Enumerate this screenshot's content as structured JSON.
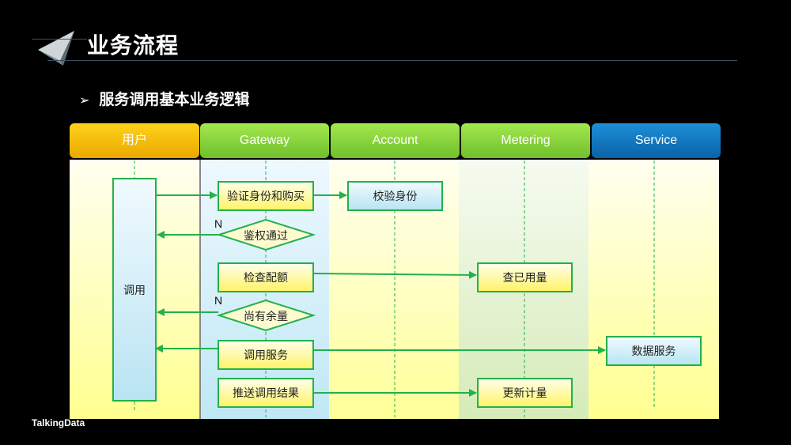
{
  "header": {
    "title": "业务流程",
    "subtitle": "服务调用基本业务逻辑",
    "subtitle_icon": "arrowhead-bullet-icon"
  },
  "lanes": [
    {
      "label": "用户",
      "color": "#f5be0a"
    },
    {
      "label": "Gateway",
      "color": "#8cd63e"
    },
    {
      "label": "Account",
      "color": "#8cd63e"
    },
    {
      "label": "Metering",
      "color": "#8cd63e"
    },
    {
      "label": "Service",
      "color": "#1479c0"
    }
  ],
  "nodes": {
    "user_call": "调用",
    "verify_purchase": "验证身份和购买",
    "check_identity": "校验身份",
    "auth_passed": "鉴权通过",
    "check_quota": "检查配额",
    "check_usage": "查已用量",
    "has_remaining": "尚有余量",
    "call_service": "调用服务",
    "data_service": "数据服务",
    "push_result": "推送调用结果",
    "update_metering": "更新计量"
  },
  "labels": {
    "no_auth": "N",
    "no_quota": "N"
  },
  "colors": {
    "connector": "#22b14c",
    "background": "#000000"
  },
  "footer": {
    "brand": "TalkingData"
  }
}
